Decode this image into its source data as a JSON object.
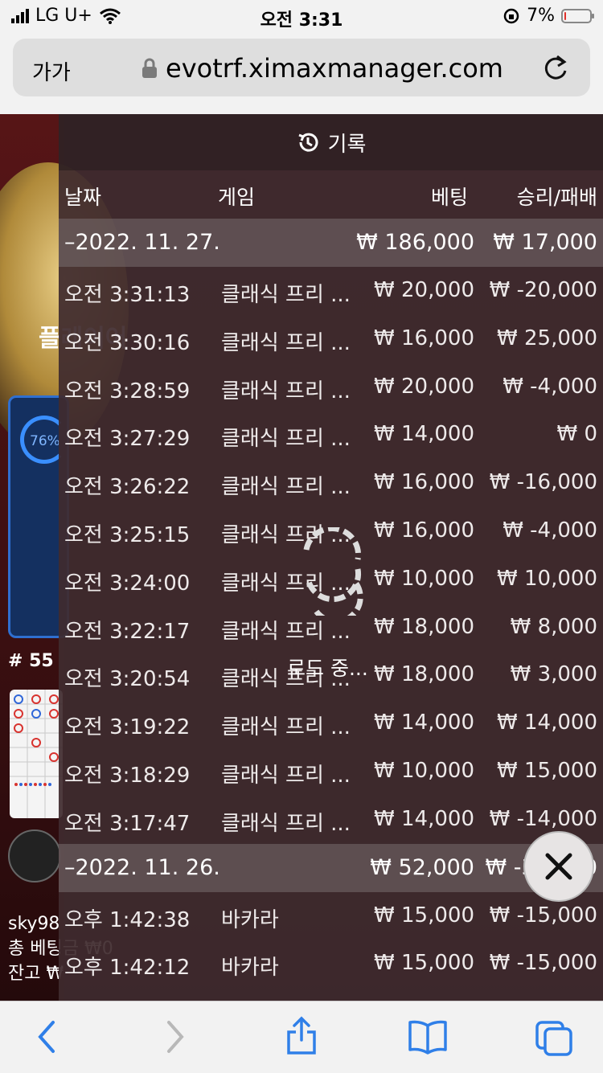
{
  "status": {
    "carrier": "LG U+",
    "time": "오전 3:31",
    "battery": "7%",
    "battery_level": 0.07
  },
  "browser": {
    "text_size_label": "가가",
    "url": "evotrf.ximaxmanager.com"
  },
  "background": {
    "card_percent": "76%",
    "card_label": "플레이어",
    "round_label": "# 55",
    "username": "sky98",
    "total_bet_label": "총 베팅금 ₩0",
    "balance_label": "잔고 ₩"
  },
  "history": {
    "title": "기록",
    "columns": {
      "date": "날짜",
      "game": "게임",
      "bet": "베팅",
      "result": "승리/패배"
    },
    "groups": [
      {
        "date": "–2022. 11. 27.",
        "bet_total": "₩ 186,000",
        "result_total": "₩ 17,000",
        "rows": [
          {
            "time": "오전 3:31:13",
            "game": "클래식 프리 ...",
            "bet": "₩ 20,000",
            "result": "₩ -20,000"
          },
          {
            "time": "오전 3:30:16",
            "game": "클래식 프리 ...",
            "bet": "₩ 16,000",
            "result": "₩ 25,000"
          },
          {
            "time": "오전 3:28:59",
            "game": "클래식 프리 ...",
            "bet": "₩ 20,000",
            "result": "₩ -4,000"
          },
          {
            "time": "오전 3:27:29",
            "game": "클래식 프리 ...",
            "bet": "₩ 14,000",
            "result": "₩ 0"
          },
          {
            "time": "오전 3:26:22",
            "game": "클래식 프리 ...",
            "bet": "₩ 16,000",
            "result": "₩ -16,000"
          },
          {
            "time": "오전 3:25:15",
            "game": "클래식 프리 ...",
            "bet": "₩ 16,000",
            "result": "₩ -4,000"
          },
          {
            "time": "오전 3:24:00",
            "game": "클래식 프리 ...",
            "bet": "₩ 10,000",
            "result": "₩ 10,000"
          },
          {
            "time": "오전 3:22:17",
            "game": "클래식 프리 ...",
            "bet": "₩ 18,000",
            "result": "₩ 8,000"
          },
          {
            "time": "오전 3:20:54",
            "game": "클래식 프리 ...",
            "bet": "₩ 18,000",
            "result": "₩ 3,000"
          },
          {
            "time": "오전 3:19:22",
            "game": "클래식 프리 ...",
            "bet": "₩ 14,000",
            "result": "₩ 14,000"
          },
          {
            "time": "오전 3:18:29",
            "game": "클래식 프리 ...",
            "bet": "₩ 10,000",
            "result": "₩ 15,000"
          },
          {
            "time": "오전 3:17:47",
            "game": "클래식 프리 ...",
            "bet": "₩ 14,000",
            "result": "₩ -14,000"
          }
        ]
      },
      {
        "date": "–2022. 11. 26.",
        "bet_total": "₩ 52,000",
        "result_total": "₩ -30,000",
        "rows": [
          {
            "time": "오후 1:42:38",
            "game": "바카라",
            "bet": "₩ 15,000",
            "result": "₩ -15,000"
          },
          {
            "time": "오후 1:42:12",
            "game": "바카라",
            "bet": "₩ 15,000",
            "result": "₩ -15,000"
          }
        ]
      }
    ],
    "loading_text": "로드 중..."
  },
  "colors": {
    "chrome": "#f2f2f2",
    "panel": "#3f2b2e",
    "link_blue": "#2f7fe8",
    "battery_red": "#e0302a"
  }
}
